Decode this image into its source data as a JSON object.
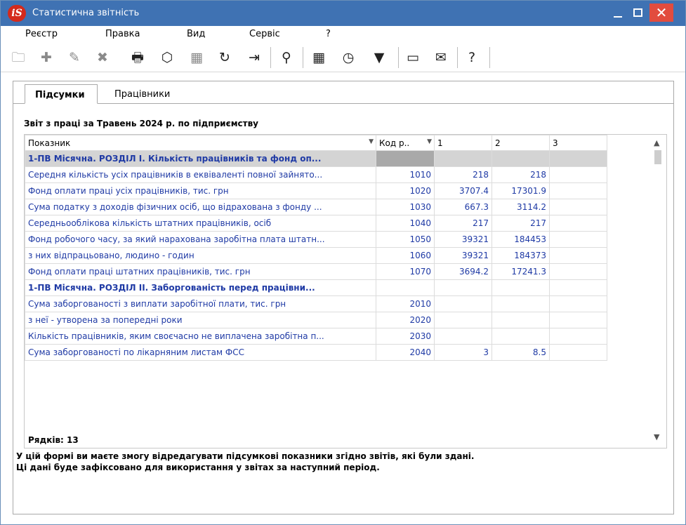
{
  "window": {
    "app_logo": "iS",
    "title": "Статистична звітність",
    "minimize_icon": "minimize-icon",
    "maximize_icon": "maximize-icon",
    "close_glyph": "✕"
  },
  "menu": [
    "Реєстр",
    "Правка",
    "Вид",
    "Сервіс",
    "?"
  ],
  "toolbar": [
    {
      "name": "open-folder-icon",
      "glyph": "🗀",
      "dim": true
    },
    {
      "name": "add-item-icon",
      "glyph": "✚",
      "dim": true
    },
    {
      "name": "edit-item-icon",
      "glyph": "✎",
      "dim": true
    },
    {
      "name": "delete-item-icon",
      "glyph": "✖",
      "dim": true
    },
    {
      "name": "print-icon",
      "glyph": "🖶",
      "dim": false
    },
    {
      "name": "box-icon",
      "glyph": "⬡",
      "dim": false
    },
    {
      "name": "excel-export-icon",
      "glyph": "▦",
      "dim": true
    },
    {
      "name": "refresh-icon",
      "glyph": "↻",
      "dim": false
    },
    {
      "name": "exit-icon",
      "glyph": "⇥",
      "dim": false
    },
    {
      "name": "search-icon",
      "glyph": "⚲",
      "dim": false
    },
    {
      "name": "table-icon",
      "glyph": "▦",
      "dim": false
    },
    {
      "name": "document-clock-icon",
      "glyph": "◷",
      "dim": false
    },
    {
      "name": "filter-icon",
      "glyph": "▼",
      "dim": false
    },
    {
      "name": "document-icon",
      "glyph": "▭",
      "dim": false
    },
    {
      "name": "mail-icon",
      "glyph": "✉",
      "dim": false
    },
    {
      "name": "help-icon",
      "glyph": "?",
      "dim": false
    }
  ],
  "tabs": [
    {
      "label": "Підсумки",
      "active": true
    },
    {
      "label": "Працівники",
      "active": false
    }
  ],
  "report_title": "Звіт з праці за Травень 2024 р. по підприємству",
  "table": {
    "columns": [
      "Показник",
      "Код р..",
      "1",
      "2",
      "3"
    ],
    "rows": [
      {
        "section": true,
        "indicator": "1-ПВ Місячна. РОЗДІЛ I. Кількість працівників та фонд оп...",
        "code": "",
        "c1": "",
        "c2": "",
        "c3": ""
      },
      {
        "section": false,
        "indicator": "Середня кількість усіх працівників в еквіваленті повної зайнято...",
        "code": "1010",
        "c1": "218",
        "c2": "218",
        "c3": ""
      },
      {
        "section": false,
        "indicator": "Фонд оплати праці усіх працівників, тис. грн",
        "code": "1020",
        "c1": "3707.4",
        "c2": "17301.9",
        "c3": ""
      },
      {
        "section": false,
        "indicator": "Сума податку з доходів фізичних осіб, що відрахована з фонду ...",
        "code": "1030",
        "c1": "667.3",
        "c2": "3114.2",
        "c3": ""
      },
      {
        "section": false,
        "indicator": "Середньооблікова кількість штатних працівників, осіб",
        "code": "1040",
        "c1": "217",
        "c2": "217",
        "c3": ""
      },
      {
        "section": false,
        "indicator": "Фонд робочого часу, за який нарахована заробітна плата штатн...",
        "code": "1050",
        "c1": "39321",
        "c2": "184453",
        "c3": ""
      },
      {
        "section": false,
        "indicator": "з них відпрацьовано, людино - годин",
        "code": "1060",
        "c1": "39321",
        "c2": "184373",
        "c3": ""
      },
      {
        "section": false,
        "indicator": "Фонд оплати праці штатних працівників, тис. грн",
        "code": "1070",
        "c1": "3694.2",
        "c2": "17241.3",
        "c3": ""
      },
      {
        "section": true,
        "indicator": "1-ПВ Місячна. РОЗДІЛ II. Заборгованість перед працівни...",
        "code": "",
        "c1": "",
        "c2": "",
        "c3": ""
      },
      {
        "section": false,
        "indicator": "Сума заборгованості з виплати заробітної плати, тис. грн",
        "code": "2010",
        "c1": "",
        "c2": "",
        "c3": ""
      },
      {
        "section": false,
        "indicator": "з неї - утворена за попередні роки",
        "code": "2020",
        "c1": "",
        "c2": "",
        "c3": ""
      },
      {
        "section": false,
        "indicator": "Кількість працівників, яким своєчасно не виплачена заробітна п...",
        "code": "2030",
        "c1": "",
        "c2": "",
        "c3": ""
      },
      {
        "section": false,
        "indicator": "Сума заборгованості по лікарняним листам ФСС",
        "code": "2040",
        "c1": "3",
        "c2": "8.5",
        "c3": ""
      }
    ]
  },
  "rows_count": "Рядків: 13",
  "footer_notes": [
    "У цій формі ви маєте змогу відредагувати підсумкові показники згідно звітів, які були здані.",
    "Ці дані буде зафіксовано для використання у звітах за наступний період."
  ]
}
